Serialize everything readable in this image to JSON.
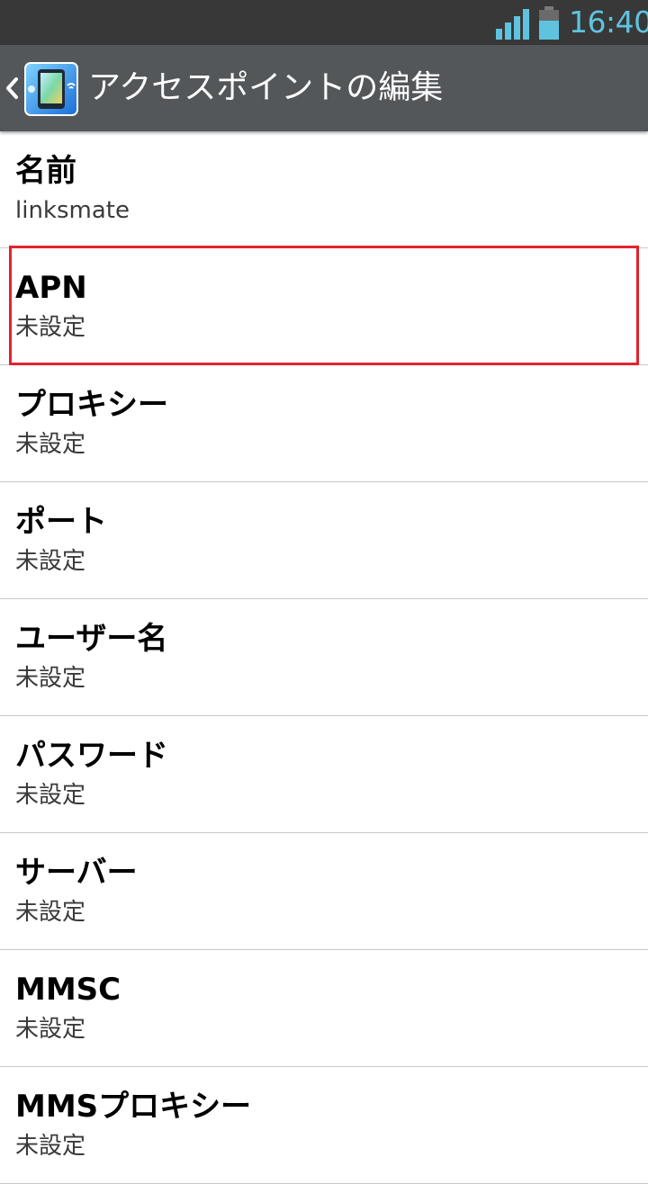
{
  "status_bar": {
    "time": "16:40",
    "signal_icon": "signal-bars-icon",
    "battery_icon": "battery-icon",
    "accent_color": "#5fc3e0"
  },
  "action_bar": {
    "title": "アクセスポイントの編集",
    "back_icon": "chevron-left-icon",
    "app_icon": "mobile-network-settings-icon",
    "background_color": "#53575a"
  },
  "settings": [
    {
      "title": "名前",
      "value": "linksmate"
    },
    {
      "title": "APN",
      "value": "未設定"
    },
    {
      "title": "プロキシー",
      "value": "未設定"
    },
    {
      "title": "ポート",
      "value": "未設定"
    },
    {
      "title": "ユーザー名",
      "value": "未設定"
    },
    {
      "title": "パスワード",
      "value": "未設定"
    },
    {
      "title": "サーバー",
      "value": "未設定"
    },
    {
      "title": "MMSC",
      "value": "未設定"
    },
    {
      "title": "MMSプロキシー",
      "value": "未設定"
    }
  ],
  "highlight": {
    "target": "APN",
    "color": "#e0242d"
  }
}
